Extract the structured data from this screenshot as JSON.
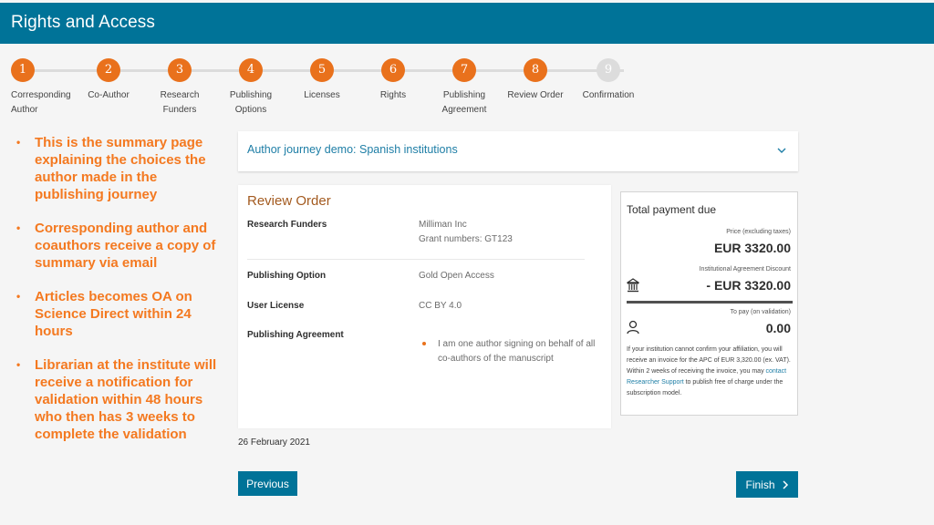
{
  "header": {
    "title": "Rights and Access"
  },
  "stepper": {
    "steps": [
      {
        "number": "1",
        "label_line1": "Corresponding",
        "label_line2": "Author",
        "state": "completed"
      },
      {
        "number": "2",
        "label_line1": "Co-Author",
        "label_line2": "",
        "state": "completed"
      },
      {
        "number": "3",
        "label_line1": "Research",
        "label_line2": "Funders",
        "state": "completed"
      },
      {
        "number": "4",
        "label_line1": "Publishing",
        "label_line2": "Options",
        "state": "completed"
      },
      {
        "number": "5",
        "label_line1": "Licenses",
        "label_line2": "",
        "state": "completed"
      },
      {
        "number": "6",
        "label_line1": "Rights",
        "label_line2": "",
        "state": "completed"
      },
      {
        "number": "7",
        "label_line1": "Publishing",
        "label_line2": "Agreement",
        "state": "completed"
      },
      {
        "number": "8",
        "label_line1": "Review Order",
        "label_line2": "",
        "state": "current"
      },
      {
        "number": "9",
        "label_line1": "Confirmation",
        "label_line2": "",
        "state": "inactive"
      }
    ]
  },
  "notes": [
    "This is the summary page explaining the choices the author made in the publishing journey",
    "Corresponding author and coauthors receive a copy of summary via email",
    "Articles becomes OA on Science Direct within 24 hours",
    "Librarian at the institute will receive a notification for validation within 48 hours who then has 3 weeks to complete the validation"
  ],
  "accordion": {
    "title": "Author journey demo: Spanish institutions",
    "icon": "chevron-down-icon"
  },
  "review": {
    "title": "Review Order",
    "research_funders_label": "Research Funders",
    "research_funders_value_1": "Milliman Inc",
    "research_funders_value_2": "Grant numbers: GT123",
    "publishing_option_label": "Publishing Option",
    "publishing_option_value": "Gold Open Access",
    "user_license_label": "User License",
    "user_license_value": "CC BY 4.0",
    "publishing_agreement_label": "Publishing Agreement",
    "publishing_agreement_items": [
      "I am one author signing on behalf of all co-authors of the manuscript"
    ]
  },
  "date": "26 February 2021",
  "payment": {
    "title": "Total payment due",
    "price_label": "Price (excluding taxes)",
    "price_value": "EUR 3320.00",
    "discount_label": "Institutional Agreement Discount",
    "discount_value": "- EUR 3320.00",
    "to_pay_label": "To pay (on validation)",
    "to_pay_value": "0.00",
    "note_before_link": "If your institution cannot confirm your affiliation, you will receive an invoice for the APC of EUR 3,320.00 (ex. VAT). Within 2 weeks of receiving the invoice, you may ",
    "note_link": "contact Researcher Support",
    "note_after_link": " to publish free of charge under the subscription model."
  },
  "buttons": {
    "previous": "Previous",
    "finish": "Finish"
  },
  "colors": {
    "brand_blue": "#007398",
    "step_orange": "#e9711c",
    "note_orange": "#f47920",
    "link_blue": "#1e7ea6"
  }
}
